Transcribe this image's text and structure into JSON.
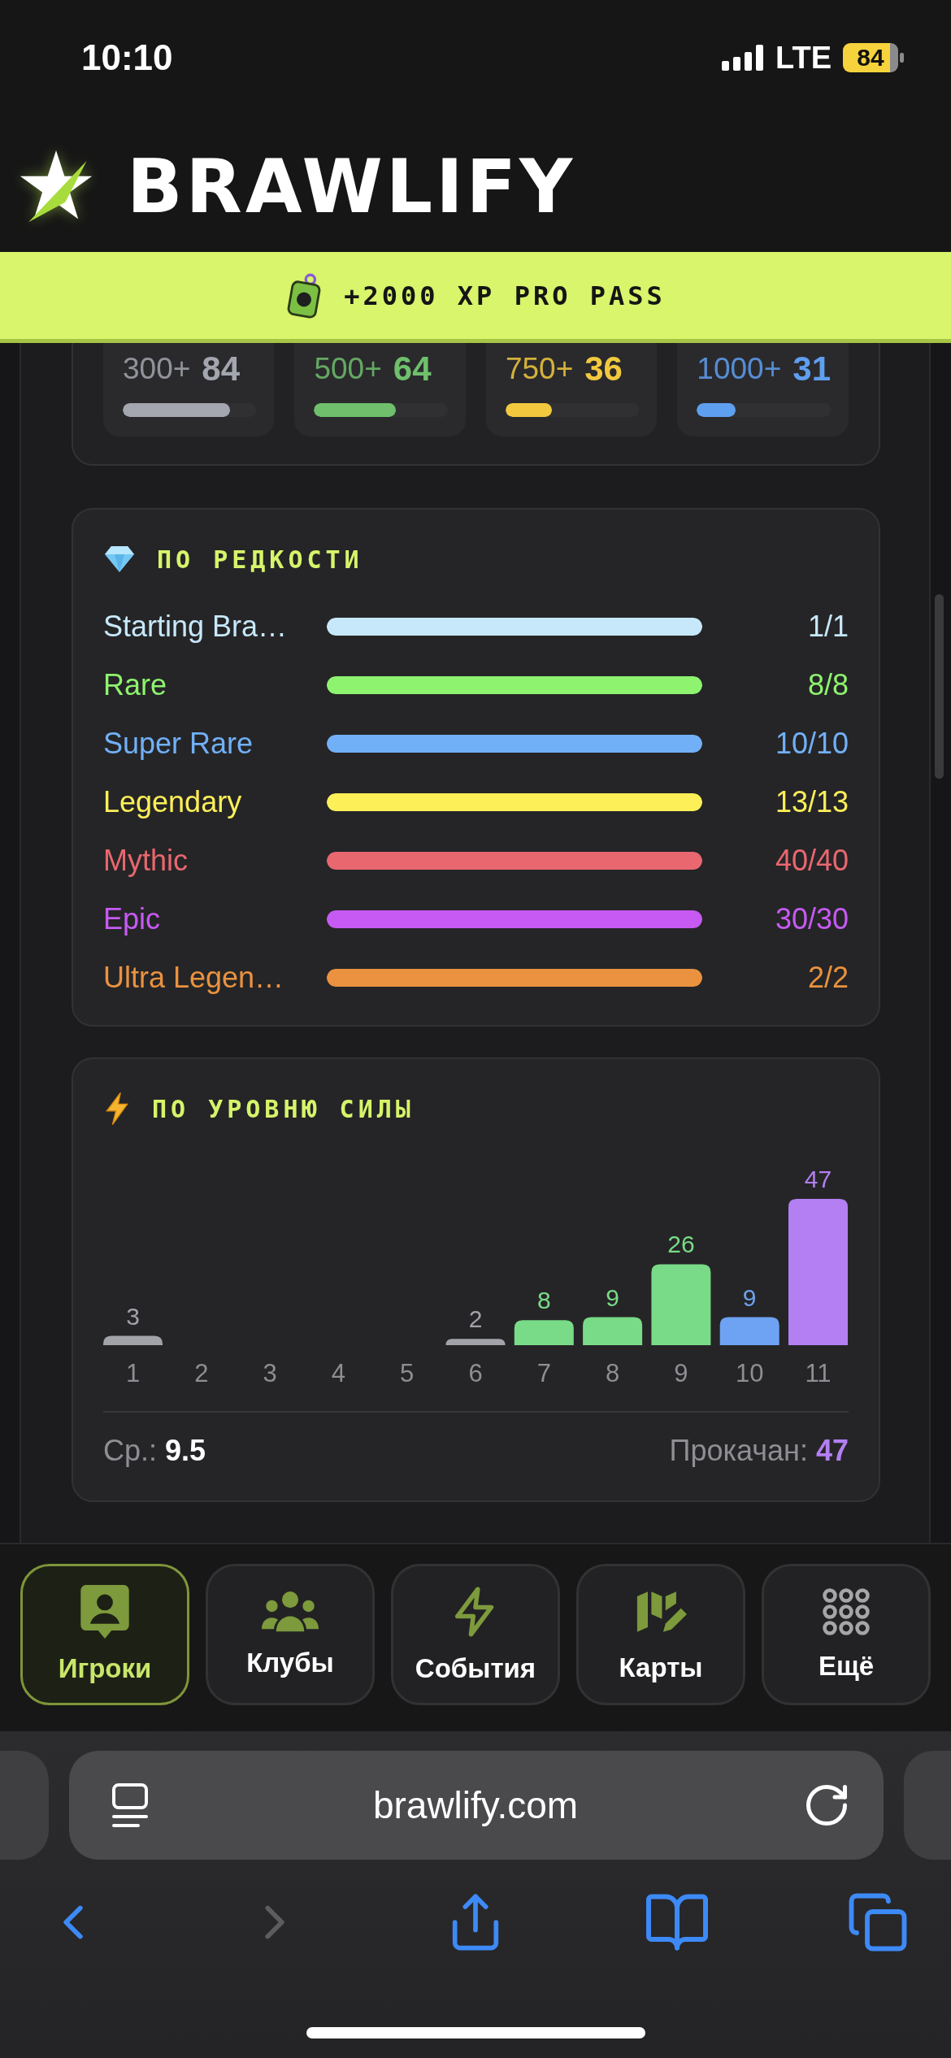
{
  "status_bar": {
    "time": "10:10",
    "network": "LTE",
    "battery": "84"
  },
  "header": {
    "logo": "BRAWLIFY"
  },
  "promo": {
    "text": "+2000 XP PRO PASS"
  },
  "tiers": [
    {
      "threshold": "300+",
      "count": "84",
      "level": 0.8,
      "color": "#a3a6ae"
    },
    {
      "threshold": "500+",
      "count": "64",
      "level": 0.61,
      "color": "#6fbf6c"
    },
    {
      "threshold": "750+",
      "count": "36",
      "level": 0.35,
      "color": "#f2c93e"
    },
    {
      "threshold": "1000+",
      "count": "31",
      "level": 0.29,
      "color": "#5f9ff0"
    }
  ],
  "rarity": {
    "title": "ПО РЕДКОСТИ",
    "rows": [
      {
        "name": "Starting Bra…",
        "count": "1/1",
        "level": 1,
        "color": "#c7e8fb"
      },
      {
        "name": "Rare",
        "count": "8/8",
        "level": 1,
        "color": "#8ef36f"
      },
      {
        "name": "Super Rare",
        "count": "10/10",
        "level": 1,
        "color": "#71b0f6"
      },
      {
        "name": "Legendary",
        "count": "13/13",
        "level": 1,
        "color": "#fdef58"
      },
      {
        "name": "Mythic",
        "count": "40/40",
        "level": 1,
        "color": "#e9676f"
      },
      {
        "name": "Epic",
        "count": "30/30",
        "level": 1,
        "color": "#c65af2"
      },
      {
        "name": "Ultra Legen…",
        "count": "2/2",
        "level": 1,
        "color": "#ea923f"
      }
    ]
  },
  "power": {
    "title": "ПО УРОВНЮ СИЛЫ",
    "chart_data": {
      "type": "bar",
      "categories": [
        "1",
        "2",
        "3",
        "4",
        "5",
        "6",
        "7",
        "8",
        "9",
        "10",
        "11"
      ],
      "series": [
        {
          "values": [
            3,
            null,
            null,
            null,
            null,
            2,
            8,
            9,
            26,
            9,
            47
          ],
          "colors": [
            "#a1a3a9",
            null,
            null,
            null,
            null,
            "#a1a3a9",
            "#79db87",
            "#79db87",
            "#79db87",
            "#6da3f2",
            "#b37ff2"
          ]
        }
      ],
      "data_labels": true
    },
    "summary": [
      {
        "label": "Ср.:",
        "value": "9.5",
        "color": "#ffffff"
      },
      {
        "label": "Прокачан:",
        "value": "47",
        "color": "#b37ff2"
      }
    ]
  },
  "nav": [
    {
      "label": "Игроки",
      "selected": true
    },
    {
      "label": "Клубы",
      "selected": false
    },
    {
      "label": "События",
      "selected": false
    },
    {
      "label": "Карты",
      "selected": false
    },
    {
      "label": "Ещё",
      "selected": false
    }
  ],
  "browser": {
    "url": "brawlify.com",
    "toolbar": [
      {
        "disabled": false
      },
      {
        "disabled": true
      },
      {
        "disabled": false
      },
      {
        "disabled": false
      },
      {
        "disabled": false
      }
    ]
  }
}
